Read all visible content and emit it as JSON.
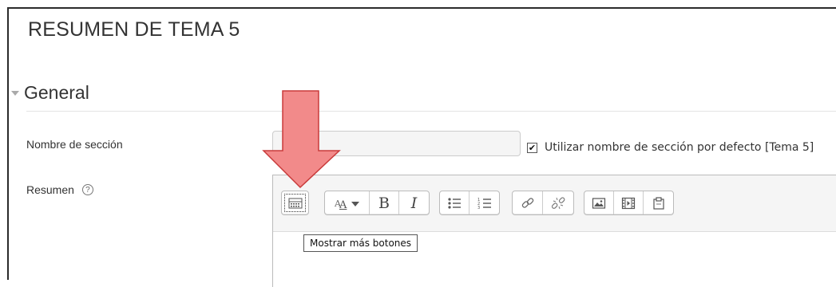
{
  "page": {
    "title": "RESUMEN DE TEMA 5"
  },
  "section": {
    "legend": "General"
  },
  "fields": {
    "name_label": "Nombre de sección",
    "name_value": "",
    "default_name_checked": true,
    "default_name_label": "Utilizar nombre de sección por defecto [Tema 5]",
    "summary_label": "Resumen"
  },
  "editor": {
    "toolbar_icons": [
      "show-more-buttons-icon",
      "font-style-icon",
      "bold-icon",
      "italic-icon",
      "unordered-list-icon",
      "ordered-list-icon",
      "link-icon",
      "unlink-icon",
      "image-icon",
      "media-icon",
      "manage-files-icon"
    ],
    "bold_glyph": "B",
    "italic_glyph": "I",
    "tooltip": "Mostrar más botones",
    "content": ""
  },
  "annotation": {
    "arrow_color": "#f28a8a",
    "arrow_border": "#c93b3b"
  }
}
